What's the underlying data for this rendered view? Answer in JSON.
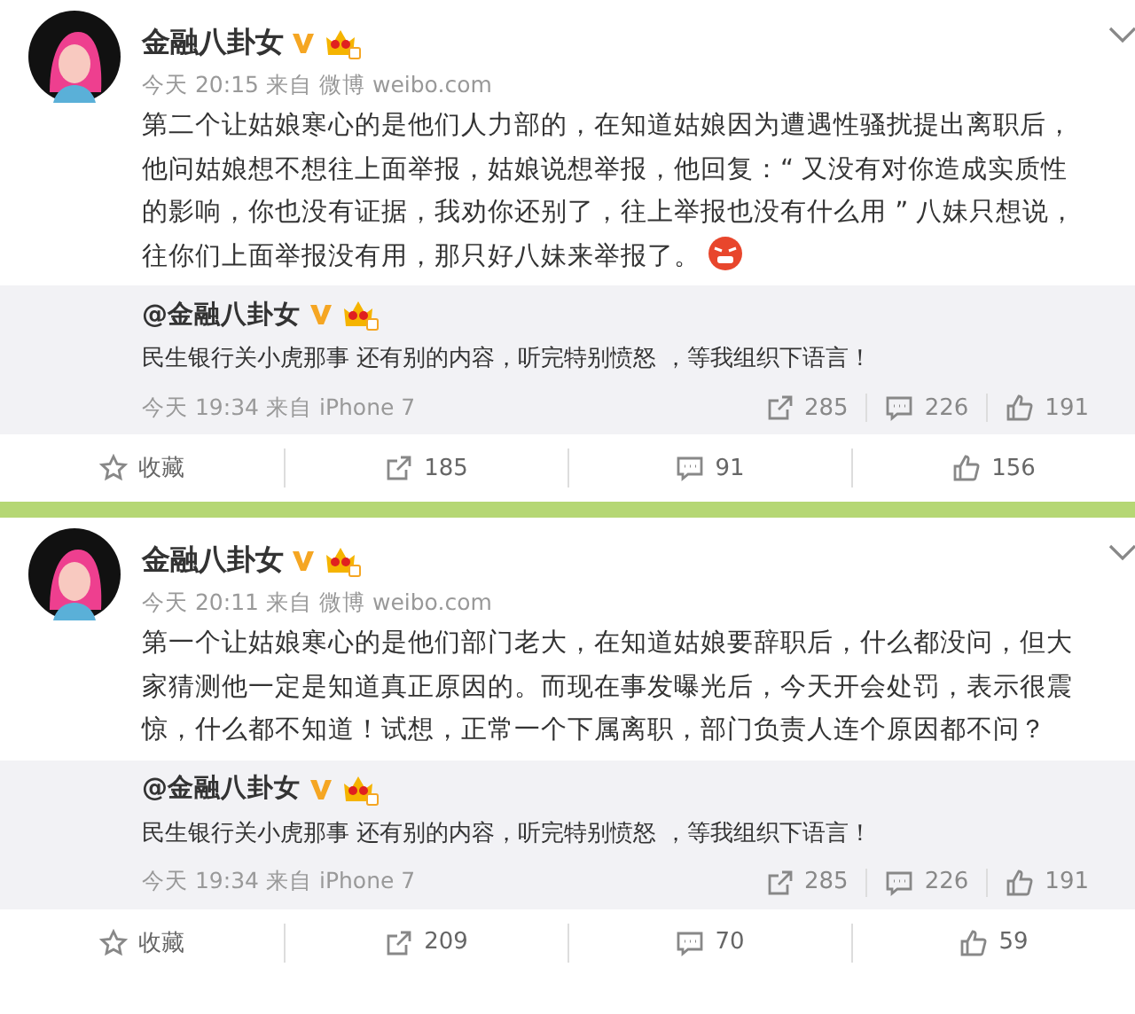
{
  "posts": [
    {
      "author": "金融八卦女",
      "verified": true,
      "time": "今天 20:15",
      "source_prefix": "来自",
      "source": "微博 weibo.com",
      "text": "第二个让姑娘寒心的是他们人力部的，在知道姑娘因为遭遇性骚扰提出离职后，他问姑娘想不想往上面举报，姑娘说想举报，他回复：“ 又没有对你造成实质性的影响，你也没有证据，我劝你还别了，往上举报也没有什么用 ” 八妹只想说，往你们上面举报没有用，那只好八妹来举报了。",
      "emoji": true,
      "repost": {
        "author": "@金融八卦女",
        "verified": true,
        "text": "民生银行关小虎那事 还有别的内容，听完特别愤怒 ，等我组织下语言！",
        "time": "今天 19:34",
        "source_prefix": "来自",
        "source": "iPhone 7",
        "stats": [
          {
            "kind": "repost",
            "label": "285"
          },
          {
            "kind": "comment",
            "label": "226"
          },
          {
            "kind": "like",
            "label": "191"
          }
        ]
      },
      "actions": [
        {
          "kind": "favorite",
          "label": "收藏"
        },
        {
          "kind": "repost",
          "label": "185"
        },
        {
          "kind": "comment",
          "label": "91"
        },
        {
          "kind": "like",
          "label": "156"
        }
      ]
    },
    {
      "author": "金融八卦女",
      "verified": true,
      "time": "今天 20:11",
      "source_prefix": "来自",
      "source": "微博 weibo.com",
      "text": "第一个让姑娘寒心的是他们部门老大，在知道姑娘要辞职后，什么都没问，但大家猜测他一定是知道真正原因的。而现在事发曝光后，今天开会处罚，表示很震惊，什么都不知道！试想，正常一个下属离职，部门负责人连个原因都不问？",
      "repost": {
        "author": "@金融八卦女",
        "verified": true,
        "text": "民生银行关小虎那事 还有别的内容，听完特别愤怒 ，等我组织下语言！",
        "time": "今天 19:34",
        "source_prefix": "来自",
        "source": "iPhone 7",
        "stats": [
          {
            "kind": "repost",
            "label": "285"
          },
          {
            "kind": "comment",
            "label": "226"
          },
          {
            "kind": "like",
            "label": "191"
          }
        ]
      },
      "actions": [
        {
          "kind": "favorite",
          "label": "收藏"
        },
        {
          "kind": "repost",
          "label": "209"
        },
        {
          "kind": "comment",
          "label": "70"
        },
        {
          "kind": "like",
          "label": "59"
        }
      ]
    }
  ]
}
